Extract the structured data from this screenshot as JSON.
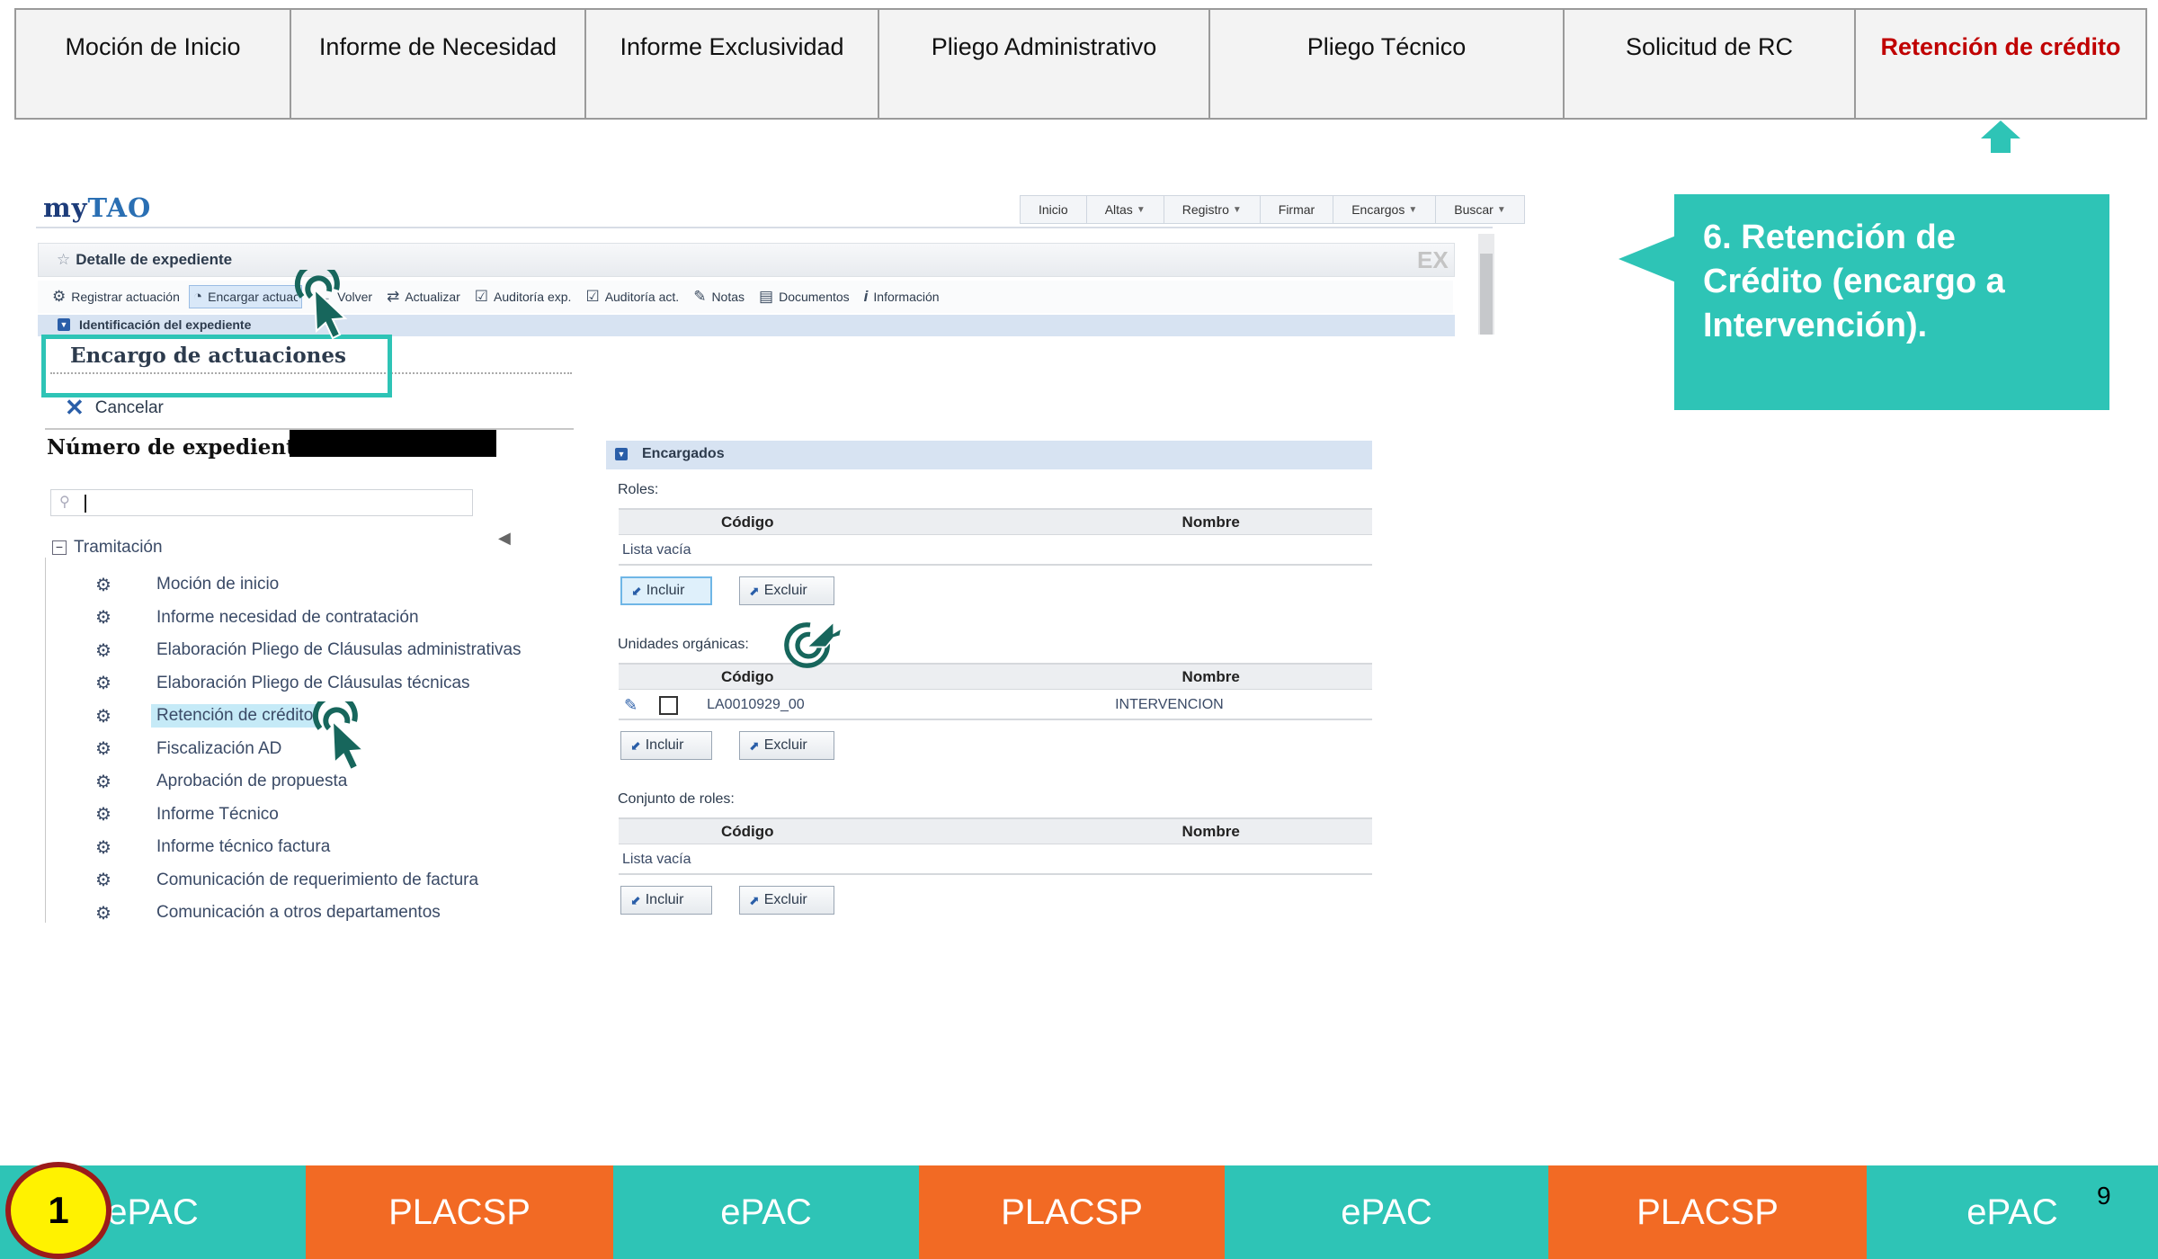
{
  "steps": [
    {
      "label": "Moción de Inicio",
      "active": false
    },
    {
      "label": "Informe de Necesidad",
      "active": false
    },
    {
      "label": "Informe Exclusividad",
      "active": false
    },
    {
      "label": "Pliego Administrativo",
      "active": false
    },
    {
      "label": "Pliego Técnico",
      "active": false
    },
    {
      "label": "Solicitud de RC",
      "active": false
    },
    {
      "label": "Retención de crédito",
      "active": true
    }
  ],
  "callout": {
    "text": "6. Retención de Crédito (encargo a Intervención)."
  },
  "app": {
    "logo_my": "my",
    "logo_tao": "TAO",
    "topnav": [
      {
        "label": "Inicio",
        "dropdown": false
      },
      {
        "label": "Altas",
        "dropdown": true
      },
      {
        "label": "Registro",
        "dropdown": true
      },
      {
        "label": "Firmar",
        "dropdown": false
      },
      {
        "label": "Encargos",
        "dropdown": true
      },
      {
        "label": "Buscar",
        "dropdown": true
      }
    ],
    "detail_title": "Detalle de expediente",
    "detail_badge": "EX",
    "toolbar": [
      {
        "icon": "gear-icon",
        "label": "Registrar actuación"
      },
      {
        "icon": "clock-icon",
        "label": "Encargar actuación"
      },
      {
        "icon": "arrow-left-icon",
        "label": "Volver"
      },
      {
        "icon": "refresh-icon",
        "label": "Actualizar"
      },
      {
        "icon": "clipboard-check-icon",
        "label": "Auditoría exp."
      },
      {
        "icon": "clipboard-check-icon",
        "label": "Auditoría act."
      },
      {
        "icon": "paperclip-icon",
        "label": "Notas"
      },
      {
        "icon": "document-icon",
        "label": "Documentos"
      },
      {
        "icon": "info-icon",
        "label": "Información"
      }
    ],
    "ident_label": "Identificación del expediente",
    "left": {
      "title": "Encargo de actuaciones",
      "cancel_label": "Cancelar",
      "expediente_label": "Número de expediente :",
      "search_value": "",
      "tree_root": "Tramitación",
      "tree_items": [
        {
          "label": "Moción de inicio",
          "selected": false
        },
        {
          "label": "Informe necesidad de contratación",
          "selected": false
        },
        {
          "label": "Elaboración Pliego de Cláusulas administrativas",
          "selected": false
        },
        {
          "label": "Elaboración Pliego de Cláusulas técnicas",
          "selected": false
        },
        {
          "label": "Retención de crédito",
          "selected": true
        },
        {
          "label": "Fiscalización AD",
          "selected": false
        },
        {
          "label": "Aprobación de propuesta",
          "selected": false
        },
        {
          "label": "Informe Técnico",
          "selected": false
        },
        {
          "label": "Informe técnico factura",
          "selected": false
        },
        {
          "label": "Comunicación de requerimiento de factura",
          "selected": false
        },
        {
          "label": "Comunicación a otros departamentos",
          "selected": false
        }
      ]
    },
    "right": {
      "header": "Encargados",
      "col_codigo": "Código",
      "col_nombre": "Nombre",
      "roles_label": "Roles:",
      "roles_empty": "Lista vacía",
      "unidades_label": "Unidades orgánicas:",
      "unidades_row": {
        "codigo": "LA0010929_00",
        "nombre": "INTERVENCION"
      },
      "conjunto_label": "Conjunto de roles:",
      "conjunto_empty": "Lista vacía",
      "incluir": "Incluir",
      "excluir": "Excluir"
    }
  },
  "bottom_bar": [
    {
      "label": "ePAC",
      "color": "#2ec4b6"
    },
    {
      "label": "PLACSP",
      "color": "#f26a24"
    },
    {
      "label": "ePAC",
      "color": "#2ec4b6"
    },
    {
      "label": "PLACSP",
      "color": "#f26a24"
    },
    {
      "label": "ePAC",
      "color": "#2ec4b6"
    },
    {
      "label": "PLACSP",
      "color": "#f26a24"
    },
    {
      "label": "ePAC",
      "color": "#2ec4b6"
    }
  ],
  "step_number": "1",
  "page_number": "9",
  "colors": {
    "teal": "#2ec4b6",
    "orange": "#f26a24",
    "active_red": "#c00000",
    "cursor": "#17665c"
  }
}
